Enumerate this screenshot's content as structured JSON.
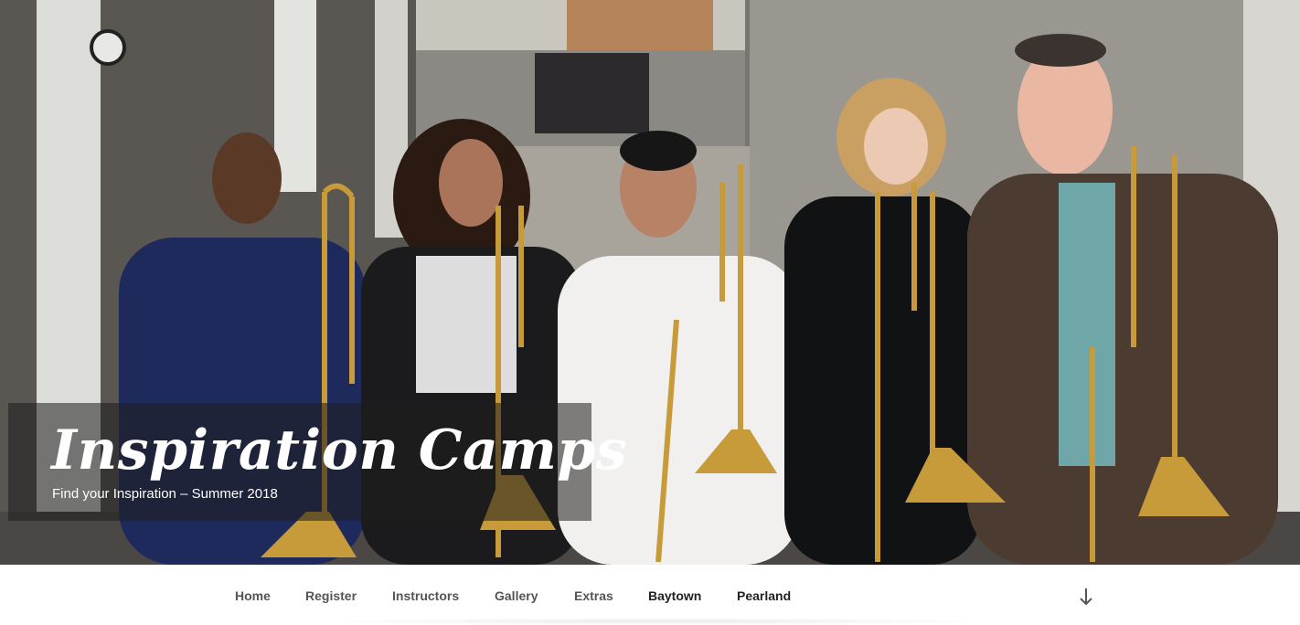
{
  "hero": {
    "title": "Inspiration Camps",
    "tagline": "Find your Inspiration – Summer 2018",
    "image_subject": "Group of students holding trombones"
  },
  "nav": {
    "items": [
      {
        "label": "Home"
      },
      {
        "label": "Register"
      },
      {
        "label": "Instructors"
      },
      {
        "label": "Gallery"
      },
      {
        "label": "Extras"
      },
      {
        "label": "Baytown"
      },
      {
        "label": "Pearland"
      }
    ],
    "scroll_icon": "arrow-down-icon"
  },
  "colors": {
    "nav_text": "#555555",
    "nav_text_active": "#222222",
    "caption_bg": "rgba(30,30,30,0.55)"
  }
}
